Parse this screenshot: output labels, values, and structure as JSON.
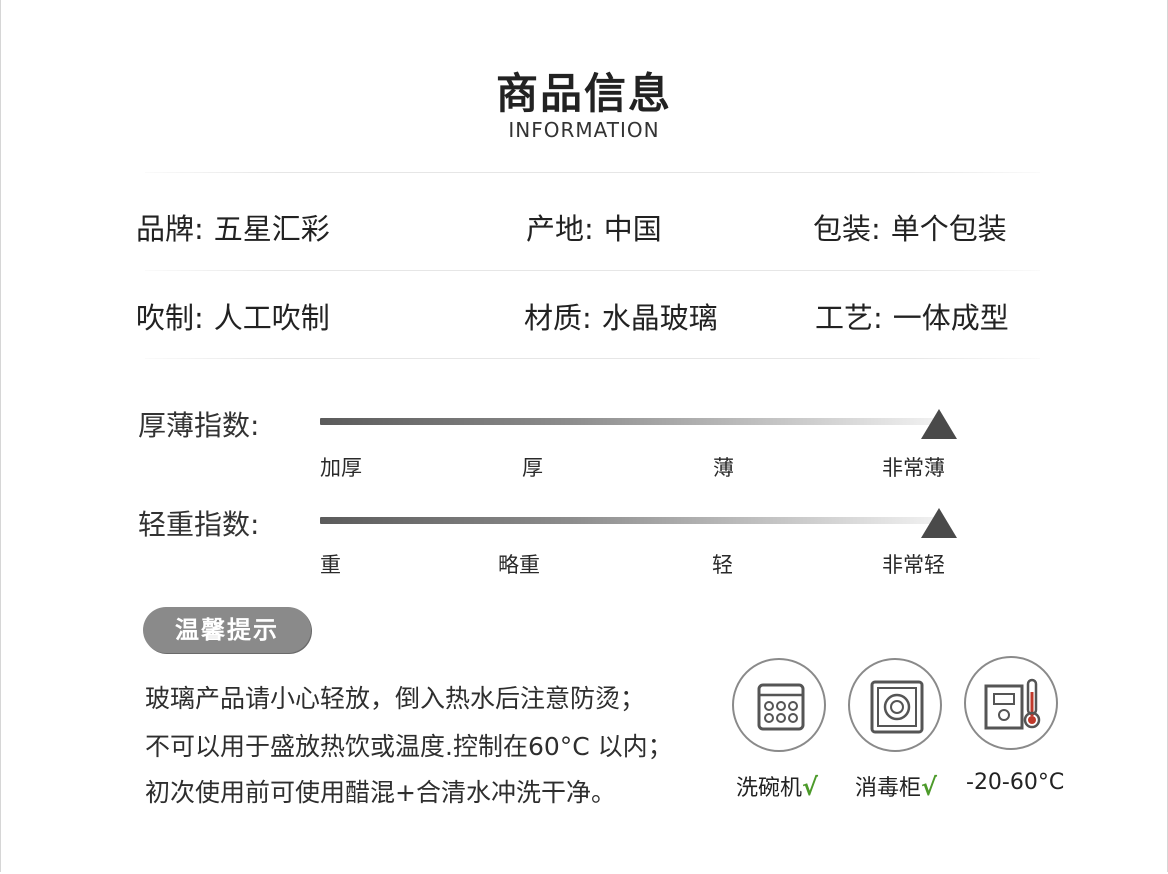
{
  "header": {
    "title": "商品信息",
    "subtitle": "INFORMATION"
  },
  "specs": [
    {
      "label": "品牌:",
      "value": "五星汇彩"
    },
    {
      "label": "产地:",
      "value": "中国"
    },
    {
      "label": "包装:",
      "value": "单个包装"
    },
    {
      "label": "吹制:",
      "value": "人工吹制"
    },
    {
      "label": "材质:",
      "value": "水晶玻璃"
    },
    {
      "label": "工艺:",
      "value": "一体成型"
    }
  ],
  "scales": [
    {
      "label": "厚薄指数:",
      "ticks": [
        "加厚",
        "厚",
        "薄",
        "非常薄"
      ],
      "selected": "非常薄"
    },
    {
      "label": "轻重指数:",
      "ticks": [
        "重",
        "略重",
        "轻",
        "非常轻"
      ],
      "selected": "非常轻"
    }
  ],
  "tips": {
    "badge": "温馨提示",
    "lines": [
      "玻璃产品请小心轻放，倒入热水后注意防烫；",
      "不可以用于盛放热饮或温度.控制在60°C 以内；",
      "初次使用前可使用醋混+合清水冲洗干净。"
    ]
  },
  "care": [
    {
      "icon": "dishwasher-icon",
      "label": "洗碗机",
      "check": "√"
    },
    {
      "icon": "sterilizer-icon",
      "label": "消毒柜",
      "check": "√"
    },
    {
      "icon": "thermometer-icon",
      "label": "-20-60°C"
    }
  ],
  "colors": {
    "check": "#4c9a2a",
    "badge": "#8a8a8a",
    "marker": "#4a4a4a"
  }
}
